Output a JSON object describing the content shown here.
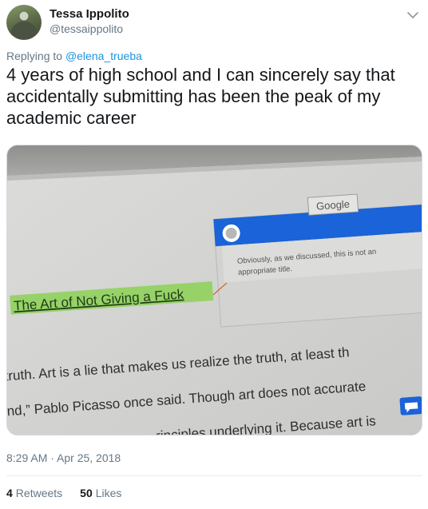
{
  "author": {
    "name": "Tessa Ippolito",
    "handle": "@tessaippolito"
  },
  "reply": {
    "prefix": "Replying to",
    "handle": "@elena_trueba"
  },
  "tweet_text": "4 years of high school and I can sincerely say that accidentally submitting has been the peak of my academic career",
  "media": {
    "google_label": "Google",
    "comment_line1": "Obviously, as we discussed, this is not an",
    "comment_line2": "appropriate title.",
    "doc_title": "The Art of Not Giving a Fuck",
    "body_line1": "truth. Art is a lie that makes us realize the truth, at least th",
    "body_line2": "nd,” Pablo Picasso once said. Though art does not accurate",
    "body_line3": "rinciples underlying it. Because art is"
  },
  "timestamp": "8:29 AM · Apr 25, 2018",
  "stats": {
    "retweets_count": "4",
    "retweets_label": "Retweets",
    "likes_count": "50",
    "likes_label": "Likes"
  },
  "colors": {
    "link": "#1b95e0",
    "secondary_text": "#657786",
    "google_blue": "#1a63d8",
    "highlight": "#8fd15c"
  }
}
